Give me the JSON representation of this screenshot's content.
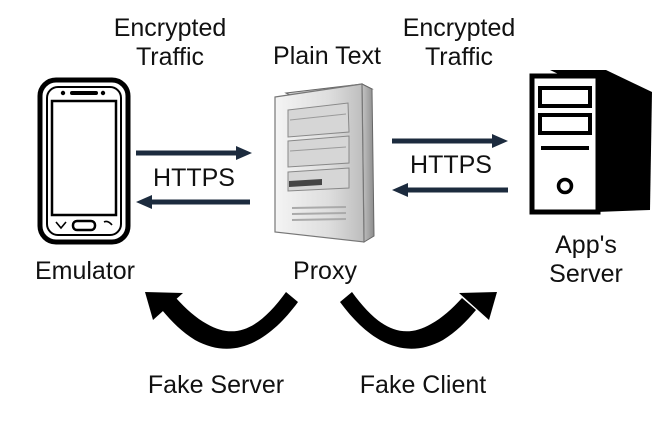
{
  "labels": {
    "left_traffic_line1": "Encrypted",
    "left_traffic_line2": "Traffic",
    "plain_text": "Plain Text",
    "right_traffic_line1": "Encrypted",
    "right_traffic_line2": "Traffic",
    "https_left": "HTTPS",
    "https_right": "HTTPS",
    "emulator": "Emulator",
    "proxy": "Proxy",
    "server_line1": "App's",
    "server_line2": "Server",
    "fake_server": "Fake Server",
    "fake_client": "Fake Client"
  },
  "icons": {
    "phone": "smartphone-icon",
    "proxy": "proxy-server-icon",
    "server": "server-tower-icon"
  },
  "colors": {
    "arrow": "#1c2b3e",
    "curve": "#000000",
    "text": "#111111"
  }
}
